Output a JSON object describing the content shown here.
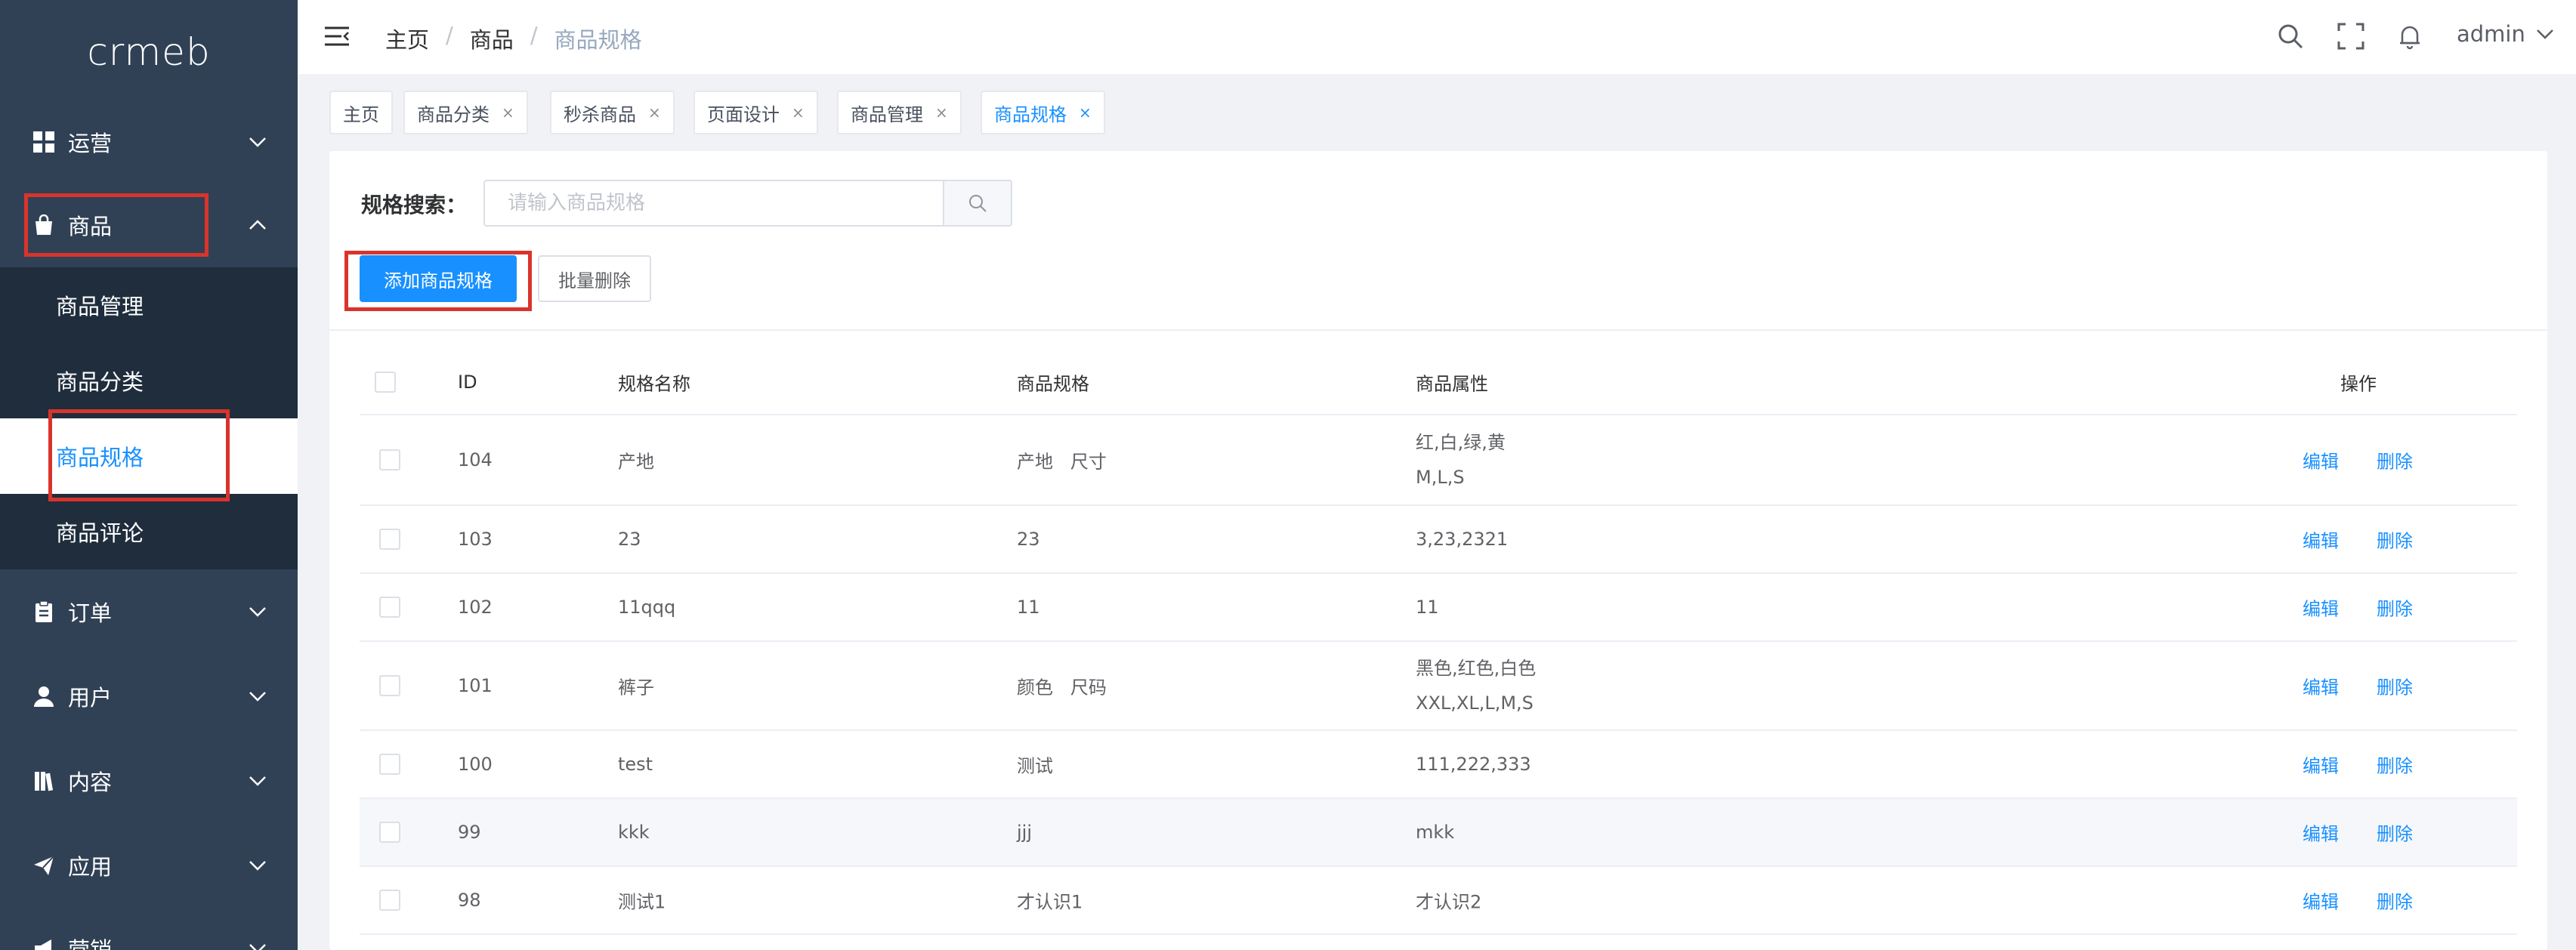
{
  "sidebar": {
    "logo": "crmeb",
    "menu": {
      "yunying": "运营",
      "shangpin": "商品",
      "dingdan": "订单",
      "yonghu": "用户",
      "neirong": "内容",
      "yingyong": "应用",
      "yingxiao": "营销"
    },
    "sub": {
      "guanli": "商品管理",
      "fenlei": "商品分类",
      "guige": "商品规格",
      "pinglun": "商品评论"
    }
  },
  "header": {
    "breadcrumb": [
      "主页",
      "商品",
      "商品规格"
    ],
    "separator": "/",
    "user": "admin"
  },
  "tags": [
    {
      "label": "主页",
      "close": ""
    },
    {
      "label": "商品分类",
      "close": "×"
    },
    {
      "label": "秒杀商品",
      "close": "×"
    },
    {
      "label": "页面设计",
      "close": "×"
    },
    {
      "label": "商品管理",
      "close": "×"
    },
    {
      "label": "商品规格",
      "close": "×"
    }
  ],
  "filter": {
    "label": "规格搜索：",
    "placeholder": "请输入商品规格"
  },
  "actions": {
    "add": "添加商品规格",
    "batch_delete": "批量删除"
  },
  "table": {
    "headers": {
      "id": "ID",
      "name": "规格名称",
      "spec": "商品规格",
      "attr": "商品属性",
      "op": "操作"
    },
    "edit": "编辑",
    "delete": "删除",
    "rows": [
      {
        "id": "104",
        "name": "产地",
        "spec": "产地   尺寸",
        "attr1": "红,白,绿,黄",
        "attr2": "M,L,S"
      },
      {
        "id": "103",
        "name": "23",
        "spec": "23",
        "attr1": "3,23,2321",
        "attr2": ""
      },
      {
        "id": "102",
        "name": "11qqq",
        "spec": "11",
        "attr1": "11",
        "attr2": ""
      },
      {
        "id": "101",
        "name": "裤子",
        "spec": "颜色   尺码",
        "attr1": "黑色,红色,白色",
        "attr2": "XXL,XL,L,M,S"
      },
      {
        "id": "100",
        "name": "test",
        "spec": "测试",
        "attr1": "111,222,333",
        "attr2": ""
      },
      {
        "id": "99",
        "name": "kkk",
        "spec": "jjj",
        "attr1": "mkk",
        "attr2": ""
      },
      {
        "id": "98",
        "name": "测试1",
        "spec": "才认识1",
        "attr1": "才认识2",
        "attr2": ""
      }
    ]
  },
  "colors": {
    "sidebar_bg": "#304156",
    "submenu_bg": "#1f2d3d",
    "accent": "#1890ff",
    "highlight_box": "#d9342b"
  }
}
